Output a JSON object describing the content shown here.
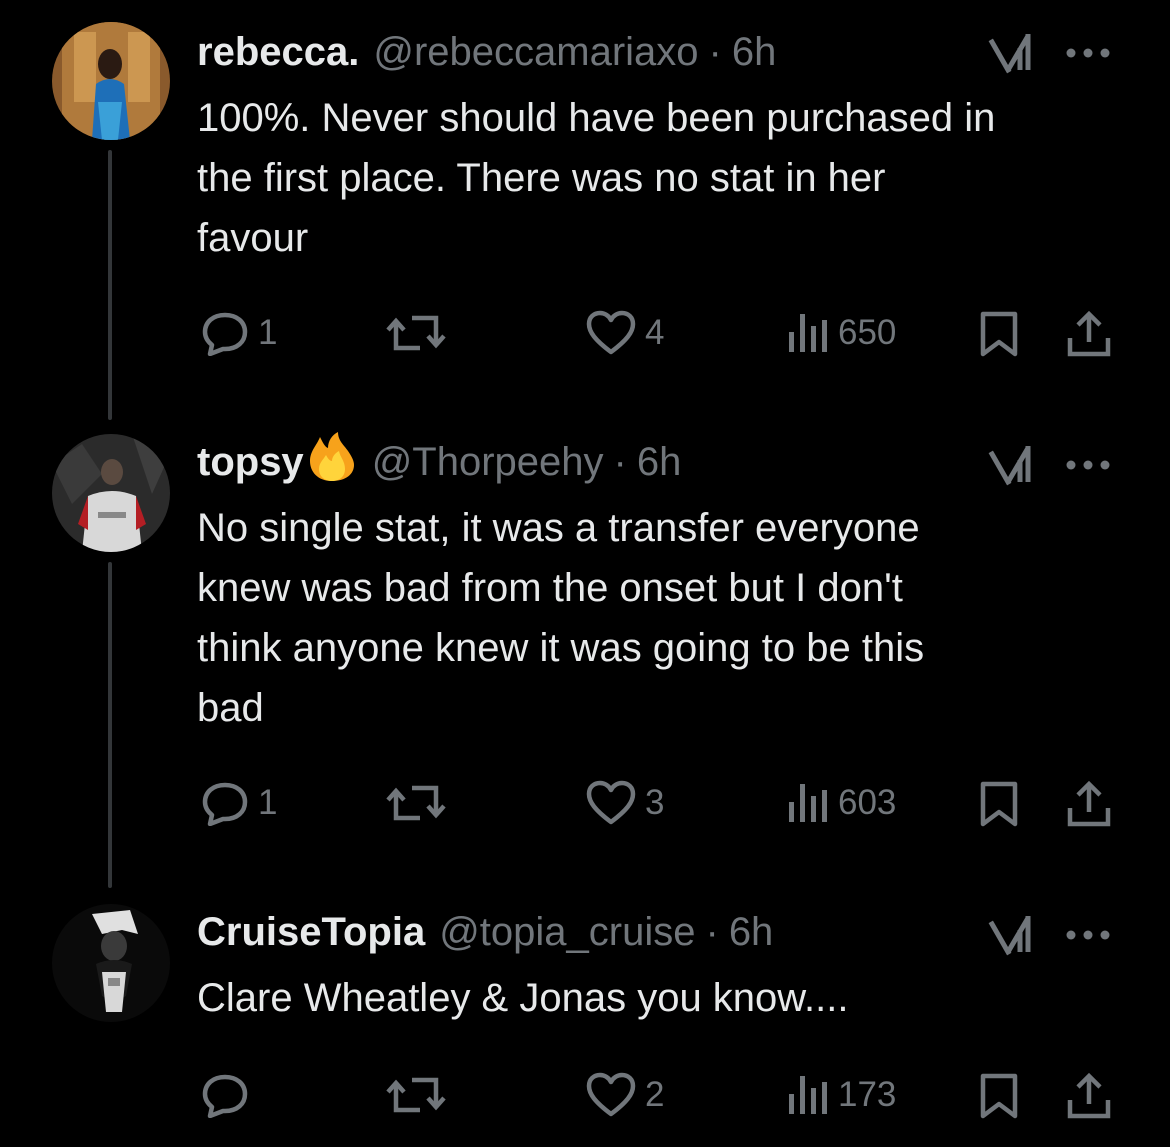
{
  "tweets": [
    {
      "name": "rebecca.",
      "handle": "@rebeccamariaxo",
      "time": "6h",
      "text_lines": [
        "100%. Never should have been purchased in",
        "the first place. There was no stat in her",
        "favour"
      ],
      "replies": "1",
      "likes": "4",
      "views": "650"
    },
    {
      "name": "topsy",
      "name_emoji": "fire-emoji",
      "handle": "@Thorpeehy",
      "time": "6h",
      "text_lines": [
        "No single stat, it was a transfer everyone",
        "knew was bad from the onset but I don't",
        "think anyone knew it was going to be this",
        "bad"
      ],
      "replies": "1",
      "likes": "3",
      "views": "603"
    },
    {
      "name": "CruiseTopia",
      "handle": "@topia_cruise",
      "time": "6h",
      "text_lines": [
        "Clare Wheatley & Jonas you know...."
      ],
      "likes": "2",
      "views": "173"
    }
  ],
  "separator": "·",
  "icons": [
    "reply-icon",
    "retweet-icon",
    "like-icon",
    "views-icon",
    "bookmark-icon",
    "share-icon",
    "grok-icon",
    "more-icon"
  ],
  "colors": {
    "background": "#000000",
    "text": "#e7e9ea",
    "secondary": "#71767b",
    "thread_line": "#333639"
  }
}
